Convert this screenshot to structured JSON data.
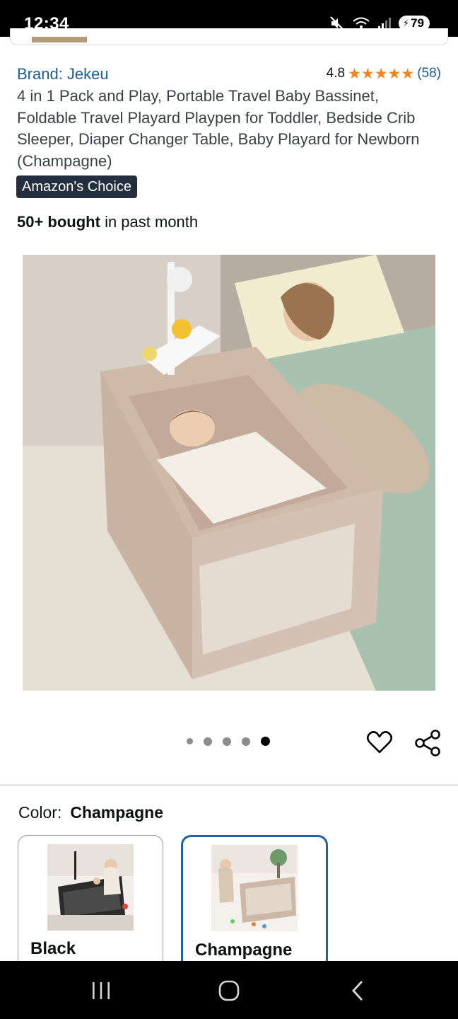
{
  "status_bar": {
    "time": "12:34",
    "battery": "79",
    "icons": [
      "mute-icon",
      "wifi-icon",
      "signal-icon",
      "battery-icon"
    ]
  },
  "product": {
    "brand": "Brand: Jekeu",
    "rating": "4.8",
    "rating_stars": 4.8,
    "rating_count": "(58)",
    "title": "4 in 1 Pack and Play, Portable Travel Baby Bassinet, Foldable Travel Playard Playpen for Toddler, Bedside Crib Sleeper, Diaper Changer Table, Baby Playard for Newborn (Champagne)",
    "badge": "Amazon's Choice",
    "bought_bold": "50+ bought",
    "bought_rest": " in past month"
  },
  "carousel": {
    "count": 5,
    "active_index": 4
  },
  "colors": {
    "label": "Color:",
    "selected": "Champagne",
    "options": [
      {
        "label": "Black"
      },
      {
        "label": "Champagne"
      }
    ]
  },
  "theme": {
    "link": "#1f5c94",
    "star": "#f0841f",
    "badge_bg": "#232f3e",
    "selected_border": "#2162a1"
  }
}
